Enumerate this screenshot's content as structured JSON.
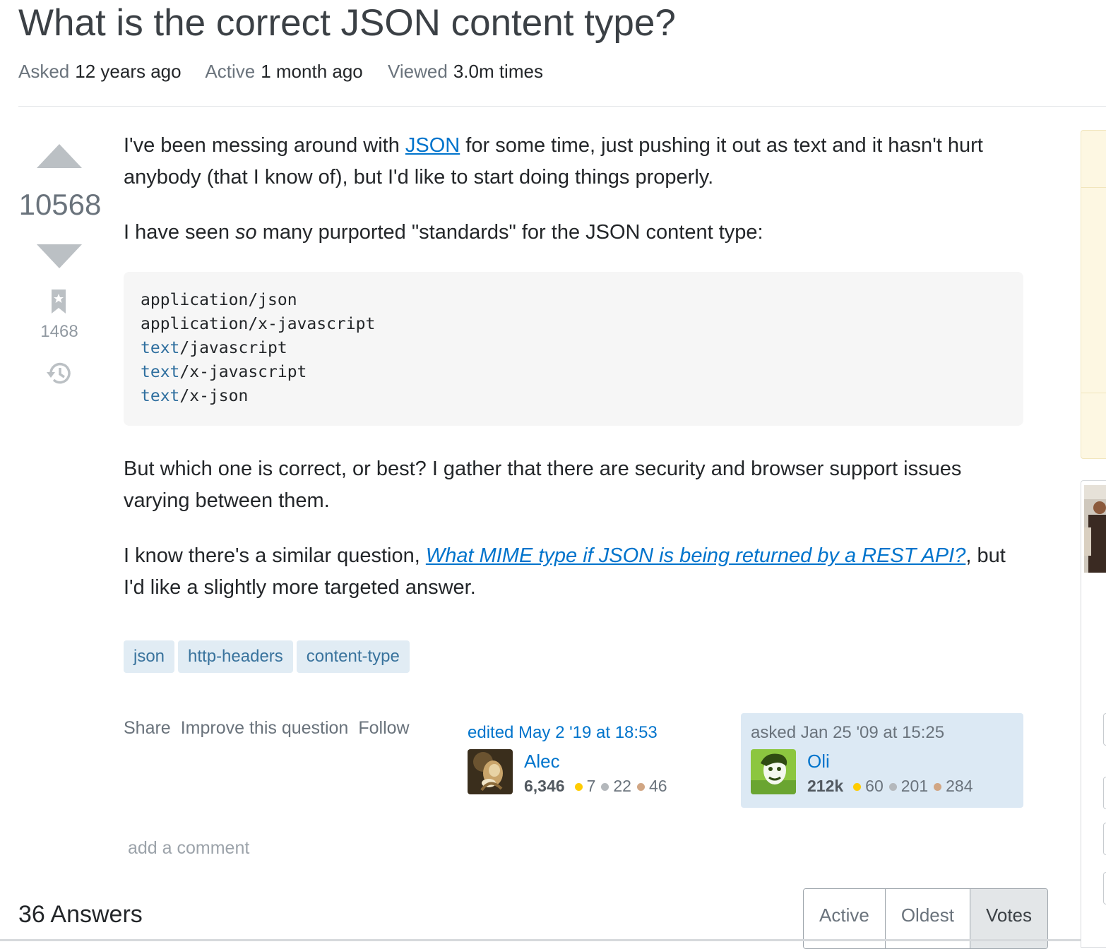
{
  "question": {
    "title": "What is the correct JSON content type?",
    "meta": {
      "asked_label": "Asked",
      "asked_value": "12 years ago",
      "active_label": "Active",
      "active_value": "1 month ago",
      "viewed_label": "Viewed",
      "viewed_value": "3.0m times"
    },
    "votes": "10568",
    "bookmarks": "1468",
    "body": {
      "p1_before": "I've been messing around with ",
      "p1_link": "JSON",
      "p1_after": " for some time, just pushing it out as text and it hasn't hurt anybody (that I know of), but I'd like to start doing things properly.",
      "p2_before": "I have seen ",
      "p2_em": "so",
      "p2_after": " many purported \"standards\" for the JSON content type:",
      "code_lines": [
        {
          "kw": "",
          "rest": "application/json"
        },
        {
          "kw": "",
          "rest": "application/x-javascript"
        },
        {
          "kw": "text",
          "rest": "/javascript"
        },
        {
          "kw": "text",
          "rest": "/x-javascript"
        },
        {
          "kw": "text",
          "rest": "/x-json"
        }
      ],
      "p3": "But which one is correct, or best? I gather that there are security and browser support issues varying between them.",
      "p4_before": "I know there's a similar question, ",
      "p4_link": "What MIME type if JSON is being returned by a REST API?",
      "p4_after": ", but I'd like a slightly more targeted answer."
    },
    "tags": [
      "json",
      "http-headers",
      "content-type"
    ],
    "menu": {
      "share": "Share",
      "improve": "Improve this question",
      "follow": "Follow"
    },
    "edited": {
      "time": "edited May 2 '19 at 18:53",
      "user": "Alec",
      "rep": "6,346",
      "gold": "7",
      "silver": "22",
      "bronze": "46"
    },
    "asked": {
      "time": "asked Jan 25 '09 at 15:25",
      "user": "Oli",
      "rep": "212k",
      "gold": "60",
      "silver": "201",
      "bronze": "284"
    },
    "add_comment": "add a comment"
  },
  "answers": {
    "count_label": "36 Answers",
    "sort_tabs": [
      "Active",
      "Oldest",
      "Votes"
    ],
    "active_sort": "Votes"
  },
  "colors": {
    "link": "#0074cc",
    "tag_bg": "#e1ecf4",
    "tag_text": "#39739d",
    "owner_card": "#dce9f4",
    "gold": "#ffcc01",
    "silver": "#b4b8bc",
    "bronze": "#d1a684"
  },
  "icons": {
    "vote_up": "triangle-up-icon",
    "vote_down": "triangle-down-icon",
    "bookmark": "bookmark-icon",
    "history": "history-icon"
  }
}
